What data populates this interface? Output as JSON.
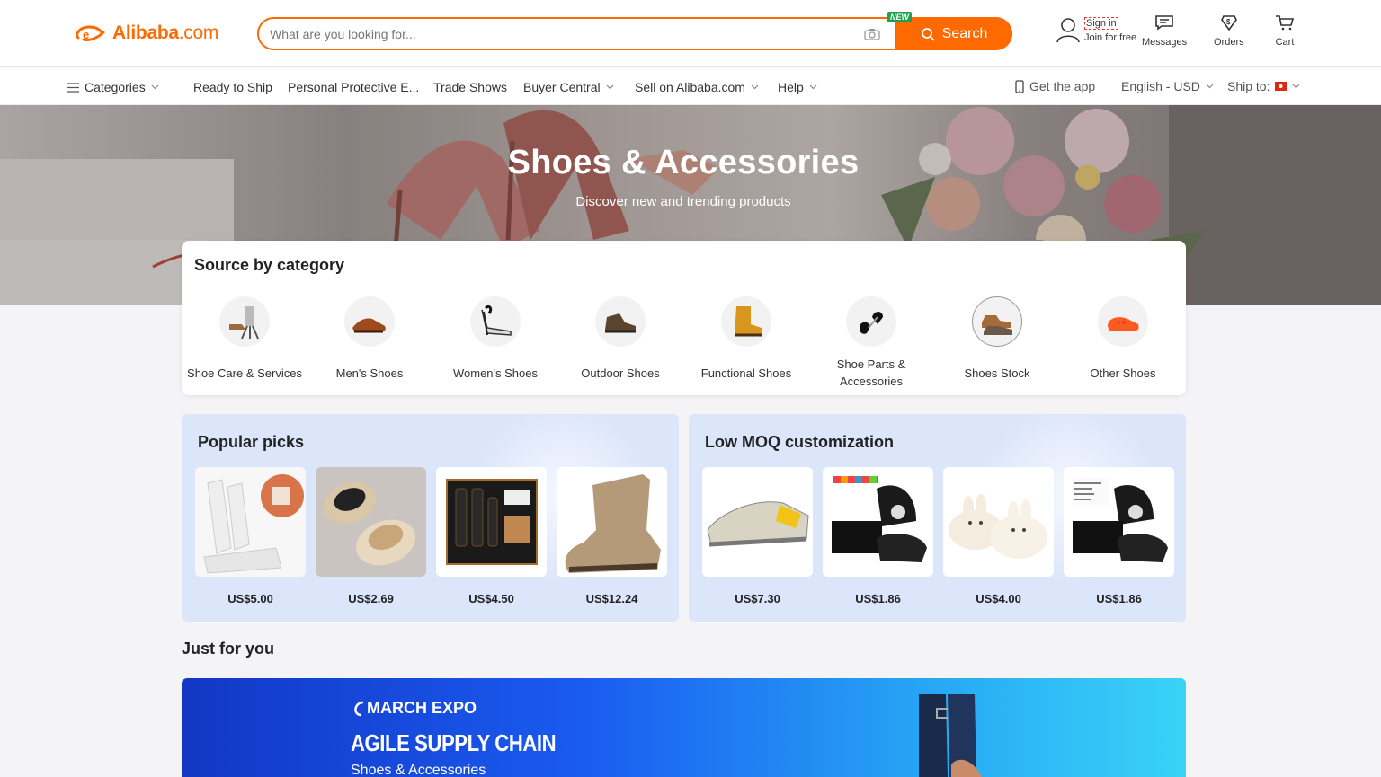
{
  "brand": {
    "logo_text": "Alibaba",
    "logo_suffix": ".com",
    "accent": "#ff6a00"
  },
  "search": {
    "placeholder": "What are you looking for...",
    "button_label": "Search",
    "new_badge": "NEW"
  },
  "account": {
    "signin": "Sign in",
    "join": "Join for free"
  },
  "header_icons": {
    "messages": "Messages",
    "orders": "Orders",
    "cart": "Cart"
  },
  "nav": {
    "categories": "Categories",
    "ready_to_ship": "Ready to Ship",
    "ppe": "Personal Protective E...",
    "trade_shows": "Trade Shows",
    "buyer_central": "Buyer Central",
    "sell": "Sell on Alibaba.com",
    "help": "Help",
    "get_app": "Get the app",
    "language": "English - USD",
    "ship_to": "Ship to:"
  },
  "hero": {
    "title": "Shoes & Accessories",
    "subtitle": "Discover new and trending products"
  },
  "source_by_category": {
    "title": "Source by category",
    "items": [
      {
        "label": "Shoe Care & Services",
        "icon": "shoe-care-icon"
      },
      {
        "label": "Men's Shoes",
        "icon": "mens-shoe-icon"
      },
      {
        "label": "Women's Shoes",
        "icon": "womens-shoe-icon"
      },
      {
        "label": "Outdoor Shoes",
        "icon": "outdoor-shoe-icon"
      },
      {
        "label": "Functional Shoes",
        "icon": "boot-icon"
      },
      {
        "label": "Shoe Parts & Accessories",
        "icon": "shoe-tree-icon"
      },
      {
        "label": "Shoes Stock",
        "icon": "shoe-stock-icon"
      },
      {
        "label": "Other Shoes",
        "icon": "clog-icon"
      }
    ]
  },
  "popular_picks": {
    "title": "Popular picks",
    "items": [
      {
        "price": "US$5.00",
        "image": "shoe-dryer"
      },
      {
        "price": "US$2.69",
        "image": "slippers"
      },
      {
        "price": "US$4.50",
        "image": "shoe-care-kit"
      },
      {
        "price": "US$12.24",
        "image": "chelsea-boot"
      }
    ]
  },
  "low_moq": {
    "title": "Low MOQ customization",
    "items": [
      {
        "price": "US$7.30",
        "image": "sandal"
      },
      {
        "price": "US$1.86",
        "image": "slides-box"
      },
      {
        "price": "US$4.00",
        "image": "bunny-slippers"
      },
      {
        "price": "US$1.86",
        "image": "custom-logo-slides"
      }
    ]
  },
  "just_for_you": {
    "title": "Just for you"
  },
  "banner": {
    "expo": "MARCH EXPO",
    "headline": "AGILE SUPPLY CHAIN",
    "sub": "Shoes & Accessories"
  }
}
